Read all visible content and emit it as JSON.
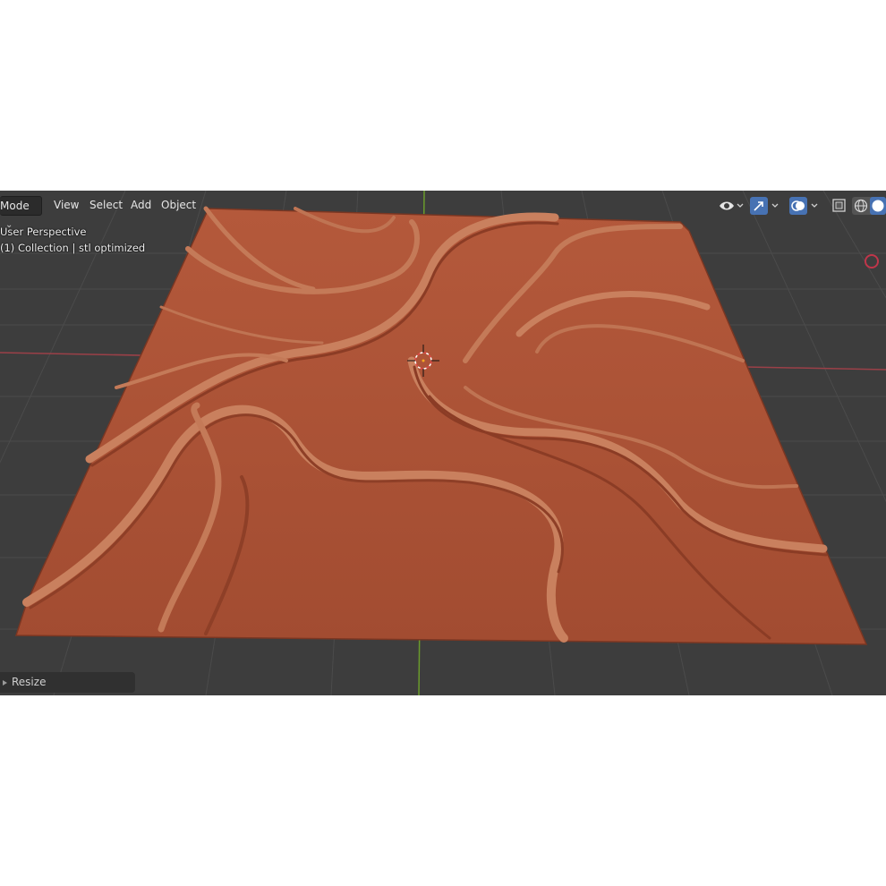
{
  "header": {
    "mode_label": "Mode",
    "menus": [
      "View",
      "Select",
      "Add",
      "Object"
    ]
  },
  "overlay": {
    "view_name": "User Perspective",
    "collection_info": "(1) Collection | stl optimized"
  },
  "tools": {
    "visibility_icon": "eye-icon",
    "gizmo_icon": "gizmo-icon",
    "overlay_icon": "overlays-icon",
    "xray_icon": "xray-icon",
    "wireframe_icon": "wireframe-shading-icon",
    "solid_icon": "solid-shading-icon"
  },
  "panel": {
    "resize_label": "Resize"
  },
  "colors": {
    "viewport_bg": "#3d3d3d",
    "grid": "#4a4a4a",
    "x_axis": "#9b4048",
    "y_axis": "#6a9b2c",
    "model": "#b0563a",
    "accent": "#4772b3"
  }
}
